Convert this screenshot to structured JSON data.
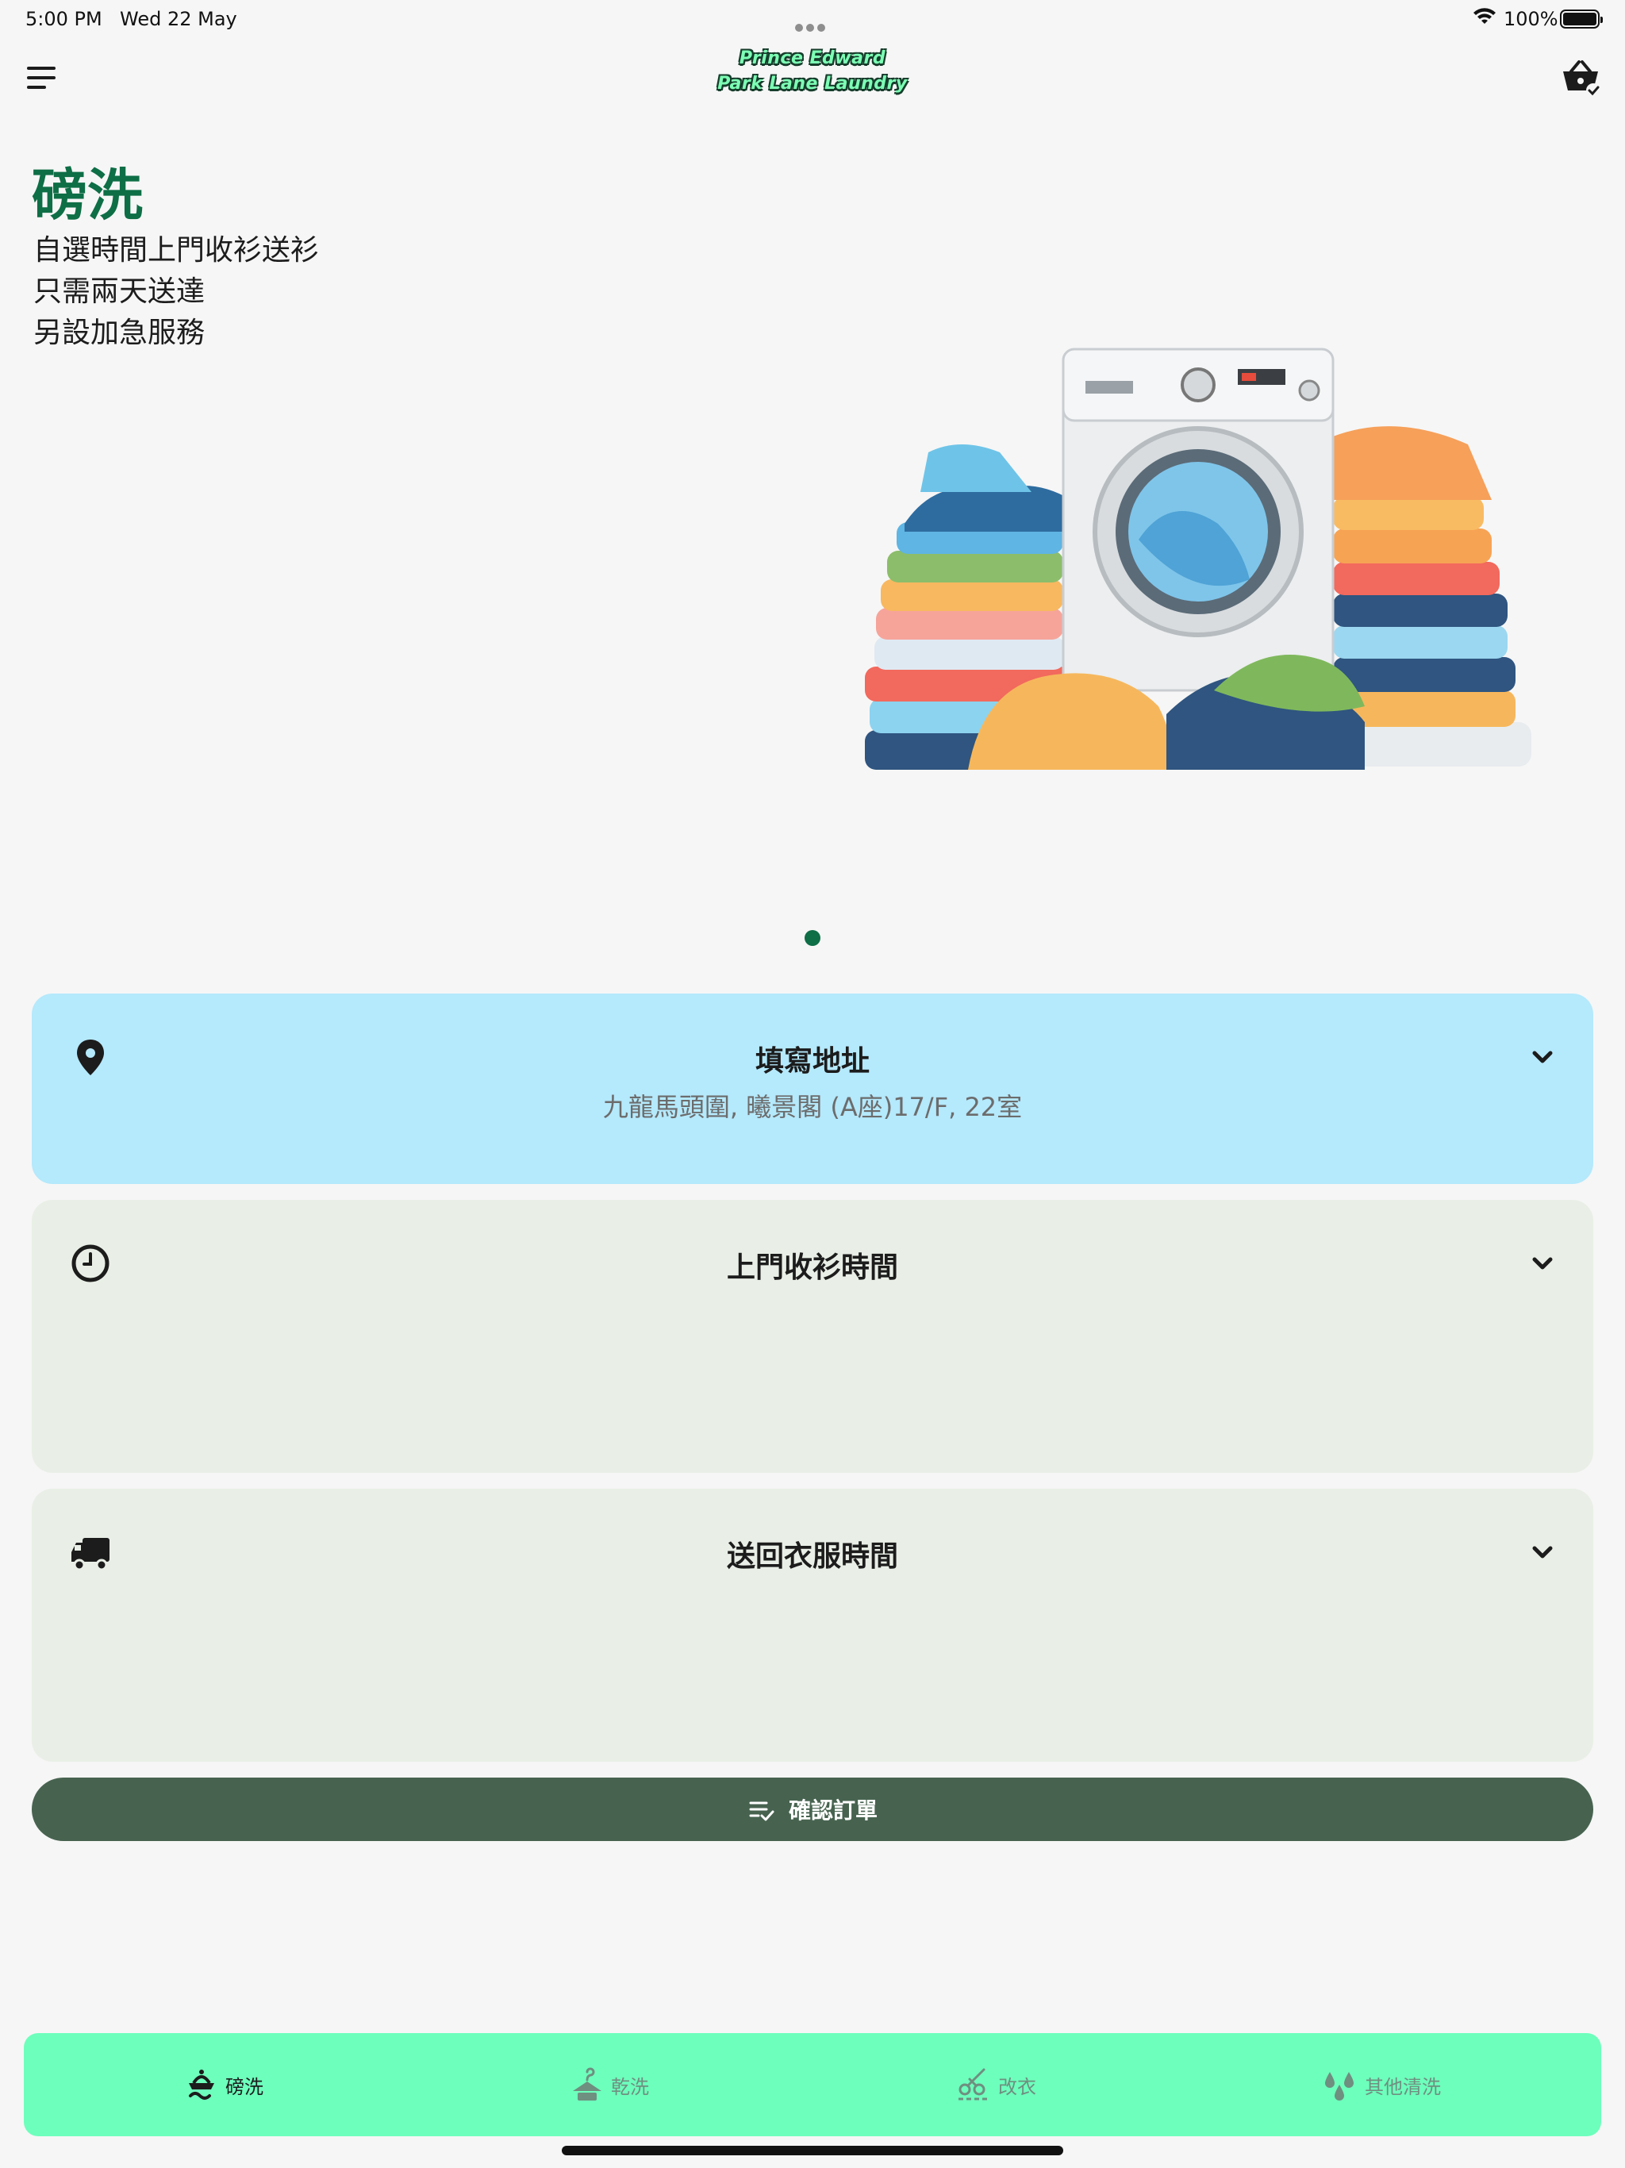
{
  "status_bar": {
    "time": "5:00 PM",
    "date": "Wed 22 May",
    "battery_pct": "100%"
  },
  "header": {
    "logo_line1": "Prince Edward",
    "logo_line2": "Park Lane Laundry",
    "menu_icon": "hamburger-menu-icon",
    "cart_icon": "basket-check-icon"
  },
  "hero": {
    "title": "磅洗",
    "lines": [
      "自選時間上門收衫送衫",
      "只需兩天送達",
      "另設加急服務"
    ],
    "image": "washing-machine-with-clothes-illustration",
    "page_count": 1,
    "active_page": 1
  },
  "cards": {
    "address": {
      "title": "填寫地址",
      "value": "九龍馬頭圍, 曦景閣 (A座)17/F, 22室",
      "icon": "location-pin-icon"
    },
    "pickup": {
      "title": "上門收衫時間",
      "icon": "clock-icon"
    },
    "delivery": {
      "title": "送回衣服時間",
      "icon": "truck-icon"
    }
  },
  "confirm": {
    "label": "確認訂單",
    "icon": "list-check-icon"
  },
  "bottom_nav": [
    {
      "label": "磅洗",
      "icon": "washing-icon",
      "active": true
    },
    {
      "label": "乾洗",
      "icon": "hanger-icon",
      "active": false
    },
    {
      "label": "改衣",
      "icon": "scissors-icon",
      "active": false
    },
    {
      "label": "其他清洗",
      "icon": "droplets-icon",
      "active": false
    }
  ],
  "colors": {
    "brand_green": "#0e6e46",
    "address_card": "#b5e9fc",
    "card_bg": "#e9efe6",
    "confirm_bg": "#476350",
    "nav_bg": "#6dffbc"
  }
}
